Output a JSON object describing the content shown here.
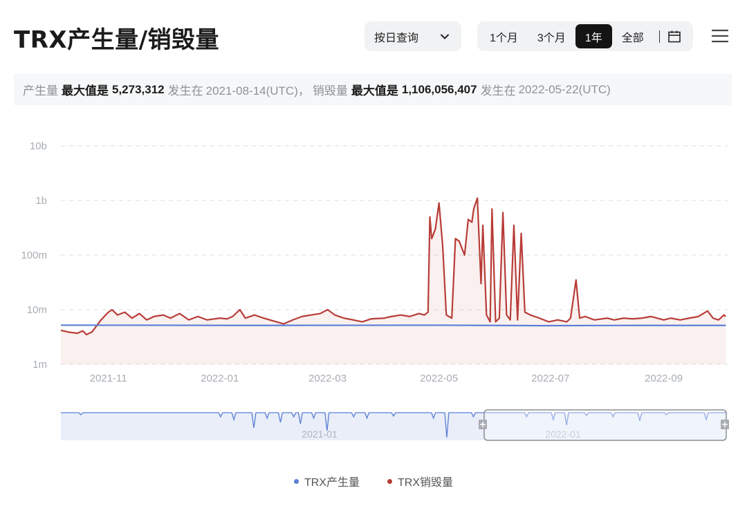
{
  "header": {
    "title": "TRX产生量/销毁量",
    "query_mode": "按日查询",
    "ranges": [
      "1个月",
      "3个月",
      "1年",
      "全部"
    ],
    "active_range": "1年"
  },
  "summary": {
    "label_produce": "产生量",
    "max_label_produce": "最大值是",
    "max_value_produce": "5,273,312",
    "occurred_label_produce": "发生在",
    "date_produce": "2021-08-14(UTC)，",
    "label_burn": "销毁量",
    "max_label_burn": "最大值是",
    "max_value_burn": "1,106,056,407",
    "occurred_label_burn": "发生在",
    "date_burn": "2022-05-22(UTC)"
  },
  "navigator": {
    "labels": [
      "2021-01",
      "2022-01"
    ]
  },
  "chart_data": {
    "type": "line",
    "scale": "log",
    "title": "",
    "xlabel": "",
    "ylabel": "",
    "ylim": [
      1000000,
      10000000000
    ],
    "ytick_labels": [
      "1m",
      "10m",
      "100m",
      "1b",
      "10b"
    ],
    "ytick_values": [
      1000000,
      10000000,
      100000000,
      1000000000,
      10000000000
    ],
    "xtick_labels": [
      "2021-11",
      "2022-01",
      "2022-03",
      "2022-05",
      "2022-07",
      "2022-09"
    ],
    "xtick_dates": [
      "2021-11-01",
      "2022-01-01",
      "2022-03-01",
      "2022-05-01",
      "2022-07-01",
      "2022-09-01"
    ],
    "grid": true,
    "legend_position": "bottom",
    "series": [
      {
        "name": "TRX产生量",
        "color": "#5b7fd6",
        "points": [
          [
            "2021-10-06",
            5200000
          ],
          [
            "2021-11-15",
            5200000
          ],
          [
            "2022-01-15",
            5150000
          ],
          [
            "2022-03-01",
            5180000
          ],
          [
            "2022-05-01",
            5200000
          ],
          [
            "2022-06-25",
            5100000
          ],
          [
            "2022-08-15",
            5150000
          ],
          [
            "2022-10-05",
            5150000
          ]
        ]
      },
      {
        "name": "TRX销毁量",
        "color": "#b83b36",
        "points": [
          [
            "2021-10-06",
            4200000
          ],
          [
            "2021-10-10",
            3900000
          ],
          [
            "2021-10-15",
            3700000
          ],
          [
            "2021-10-18",
            4100000
          ],
          [
            "2021-10-20",
            3500000
          ],
          [
            "2021-10-23",
            3900000
          ],
          [
            "2021-10-28",
            6500000
          ],
          [
            "2021-11-01",
            9000000
          ],
          [
            "2021-11-03",
            10000000
          ],
          [
            "2021-11-06",
            8000000
          ],
          [
            "2021-11-10",
            9000000
          ],
          [
            "2021-11-14",
            7000000
          ],
          [
            "2021-11-18",
            8500000
          ],
          [
            "2021-11-22",
            6500000
          ],
          [
            "2021-11-26",
            7500000
          ],
          [
            "2021-12-01",
            8000000
          ],
          [
            "2021-12-05",
            7000000
          ],
          [
            "2021-12-10",
            8500000
          ],
          [
            "2021-12-15",
            6500000
          ],
          [
            "2021-12-20",
            7500000
          ],
          [
            "2021-12-25",
            6500000
          ],
          [
            "2022-01-01",
            7000000
          ],
          [
            "2022-01-05",
            6800000
          ],
          [
            "2022-01-08",
            7500000
          ],
          [
            "2022-01-12",
            10000000
          ],
          [
            "2022-01-15",
            7000000
          ],
          [
            "2022-01-20",
            8000000
          ],
          [
            "2022-01-25",
            7000000
          ],
          [
            "2022-02-01",
            6000000
          ],
          [
            "2022-02-05",
            5500000
          ],
          [
            "2022-02-10",
            6500000
          ],
          [
            "2022-02-15",
            7500000
          ],
          [
            "2022-02-20",
            8000000
          ],
          [
            "2022-02-25",
            8500000
          ],
          [
            "2022-03-01",
            10000000
          ],
          [
            "2022-03-05",
            8000000
          ],
          [
            "2022-03-10",
            7000000
          ],
          [
            "2022-03-15",
            6500000
          ],
          [
            "2022-03-20",
            6000000
          ],
          [
            "2022-03-25",
            6800000
          ],
          [
            "2022-04-01",
            7000000
          ],
          [
            "2022-04-05",
            7500000
          ],
          [
            "2022-04-10",
            8000000
          ],
          [
            "2022-04-15",
            7500000
          ],
          [
            "2022-04-20",
            8500000
          ],
          [
            "2022-04-23",
            8000000
          ],
          [
            "2022-04-25",
            9000000
          ],
          [
            "2022-04-26",
            500000000
          ],
          [
            "2022-04-27",
            200000000
          ],
          [
            "2022-04-29",
            300000000
          ],
          [
            "2022-05-01",
            900000000
          ],
          [
            "2022-05-03",
            150000000
          ],
          [
            "2022-05-05",
            8000000
          ],
          [
            "2022-05-08",
            7000000
          ],
          [
            "2022-05-10",
            200000000
          ],
          [
            "2022-05-12",
            180000000
          ],
          [
            "2022-05-15",
            100000000
          ],
          [
            "2022-05-17",
            450000000
          ],
          [
            "2022-05-19",
            400000000
          ],
          [
            "2022-05-20",
            700000000
          ],
          [
            "2022-05-22",
            1106000000
          ],
          [
            "2022-05-24",
            30000000
          ],
          [
            "2022-05-25",
            350000000
          ],
          [
            "2022-05-27",
            8000000
          ],
          [
            "2022-05-29",
            6000000
          ],
          [
            "2022-05-30",
            700000000
          ],
          [
            "2022-06-01",
            6000000
          ],
          [
            "2022-06-03",
            7000000
          ],
          [
            "2022-06-05",
            600000000
          ],
          [
            "2022-06-07",
            8000000
          ],
          [
            "2022-06-09",
            6500000
          ],
          [
            "2022-06-11",
            350000000
          ],
          [
            "2022-06-13",
            6500000
          ],
          [
            "2022-06-15",
            250000000
          ],
          [
            "2022-06-17",
            9000000
          ],
          [
            "2022-06-20",
            8000000
          ],
          [
            "2022-06-25",
            7000000
          ],
          [
            "2022-06-30",
            6000000
          ],
          [
            "2022-07-05",
            6500000
          ],
          [
            "2022-07-10",
            6000000
          ],
          [
            "2022-07-12",
            7000000
          ],
          [
            "2022-07-15",
            35000000
          ],
          [
            "2022-07-17",
            7000000
          ],
          [
            "2022-07-20",
            7500000
          ],
          [
            "2022-07-25",
            6500000
          ],
          [
            "2022-08-01",
            7000000
          ],
          [
            "2022-08-05",
            6500000
          ],
          [
            "2022-08-10",
            7000000
          ],
          [
            "2022-08-15",
            6800000
          ],
          [
            "2022-08-20",
            7000000
          ],
          [
            "2022-08-25",
            7500000
          ],
          [
            "2022-09-01",
            6500000
          ],
          [
            "2022-09-05",
            7000000
          ],
          [
            "2022-09-10",
            6500000
          ],
          [
            "2022-09-15",
            7000000
          ],
          [
            "2022-09-20",
            7500000
          ],
          [
            "2022-09-25",
            9500000
          ],
          [
            "2022-09-28",
            7000000
          ],
          [
            "2022-10-01",
            6500000
          ],
          [
            "2022-10-04",
            8000000
          ],
          [
            "2022-10-05",
            7500000
          ]
        ]
      }
    ]
  }
}
